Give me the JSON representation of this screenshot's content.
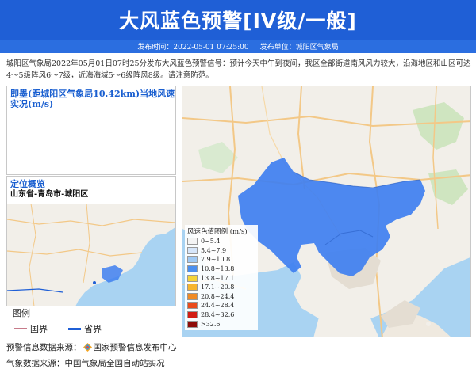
{
  "header": {
    "title": "大风蓝色预警[IV级/一般]",
    "publish_time_label": "发布时间：2022-05-01 07:25:00",
    "publish_unit_label": "发布单位：城阳区气象局"
  },
  "description": "城阳区气象局2022年05月01日07时25分发布大风蓝色预警信号：预计今天中午到夜间，我区全部街道南风风力较大，沿海地区和山区可达4～5级阵风6～7级，近海海域5～6级阵风8级。请注意防范。",
  "wind_panel": {
    "title": "即墨(距城阳区气象局10.42km)当地风速实况(m/s)"
  },
  "location_panel": {
    "title": "定位概览",
    "location": "山东省-青岛市-城阳区"
  },
  "map_legend": {
    "title": "图例",
    "items": [
      {
        "label": "国界",
        "color": "#c77b8a"
      },
      {
        "label": "省界",
        "color": "#1f5fd6"
      }
    ]
  },
  "wind_scale": {
    "title": "风速色值图例 (m/s)",
    "items": [
      {
        "label": "0~5.4",
        "color": "#f4f4f4"
      },
      {
        "label": "5.4~7.9",
        "color": "#d6e6fa"
      },
      {
        "label": "7.9~10.8",
        "color": "#9ec9f5"
      },
      {
        "label": "10.8~13.8",
        "color": "#4a8ff0"
      },
      {
        "label": "13.8~17.1",
        "color": "#f5d43a"
      },
      {
        "label": "17.1~20.8",
        "color": "#f7b52e"
      },
      {
        "label": "20.8~24.4",
        "color": "#f08a24"
      },
      {
        "label": "24.4~28.4",
        "color": "#ea4b1c"
      },
      {
        "label": "28.4~32.6",
        "color": "#d21d14"
      },
      {
        "label": ">32.6",
        "color": "#8e0d0a"
      }
    ]
  },
  "sources": {
    "warning_label": "预警信息数据来源：",
    "warning_value": "国家预警信息发布中心",
    "weather_label": "气象数据来源：",
    "weather_value": "中国气象局全国自动站实况"
  },
  "colors": {
    "title_bg": "#1f5fd6",
    "meta_bg": "#2b6ee0",
    "panel_title": "#1a5fd0",
    "warning_area": "#3f7ff0",
    "sea": "#a9d3f2"
  }
}
